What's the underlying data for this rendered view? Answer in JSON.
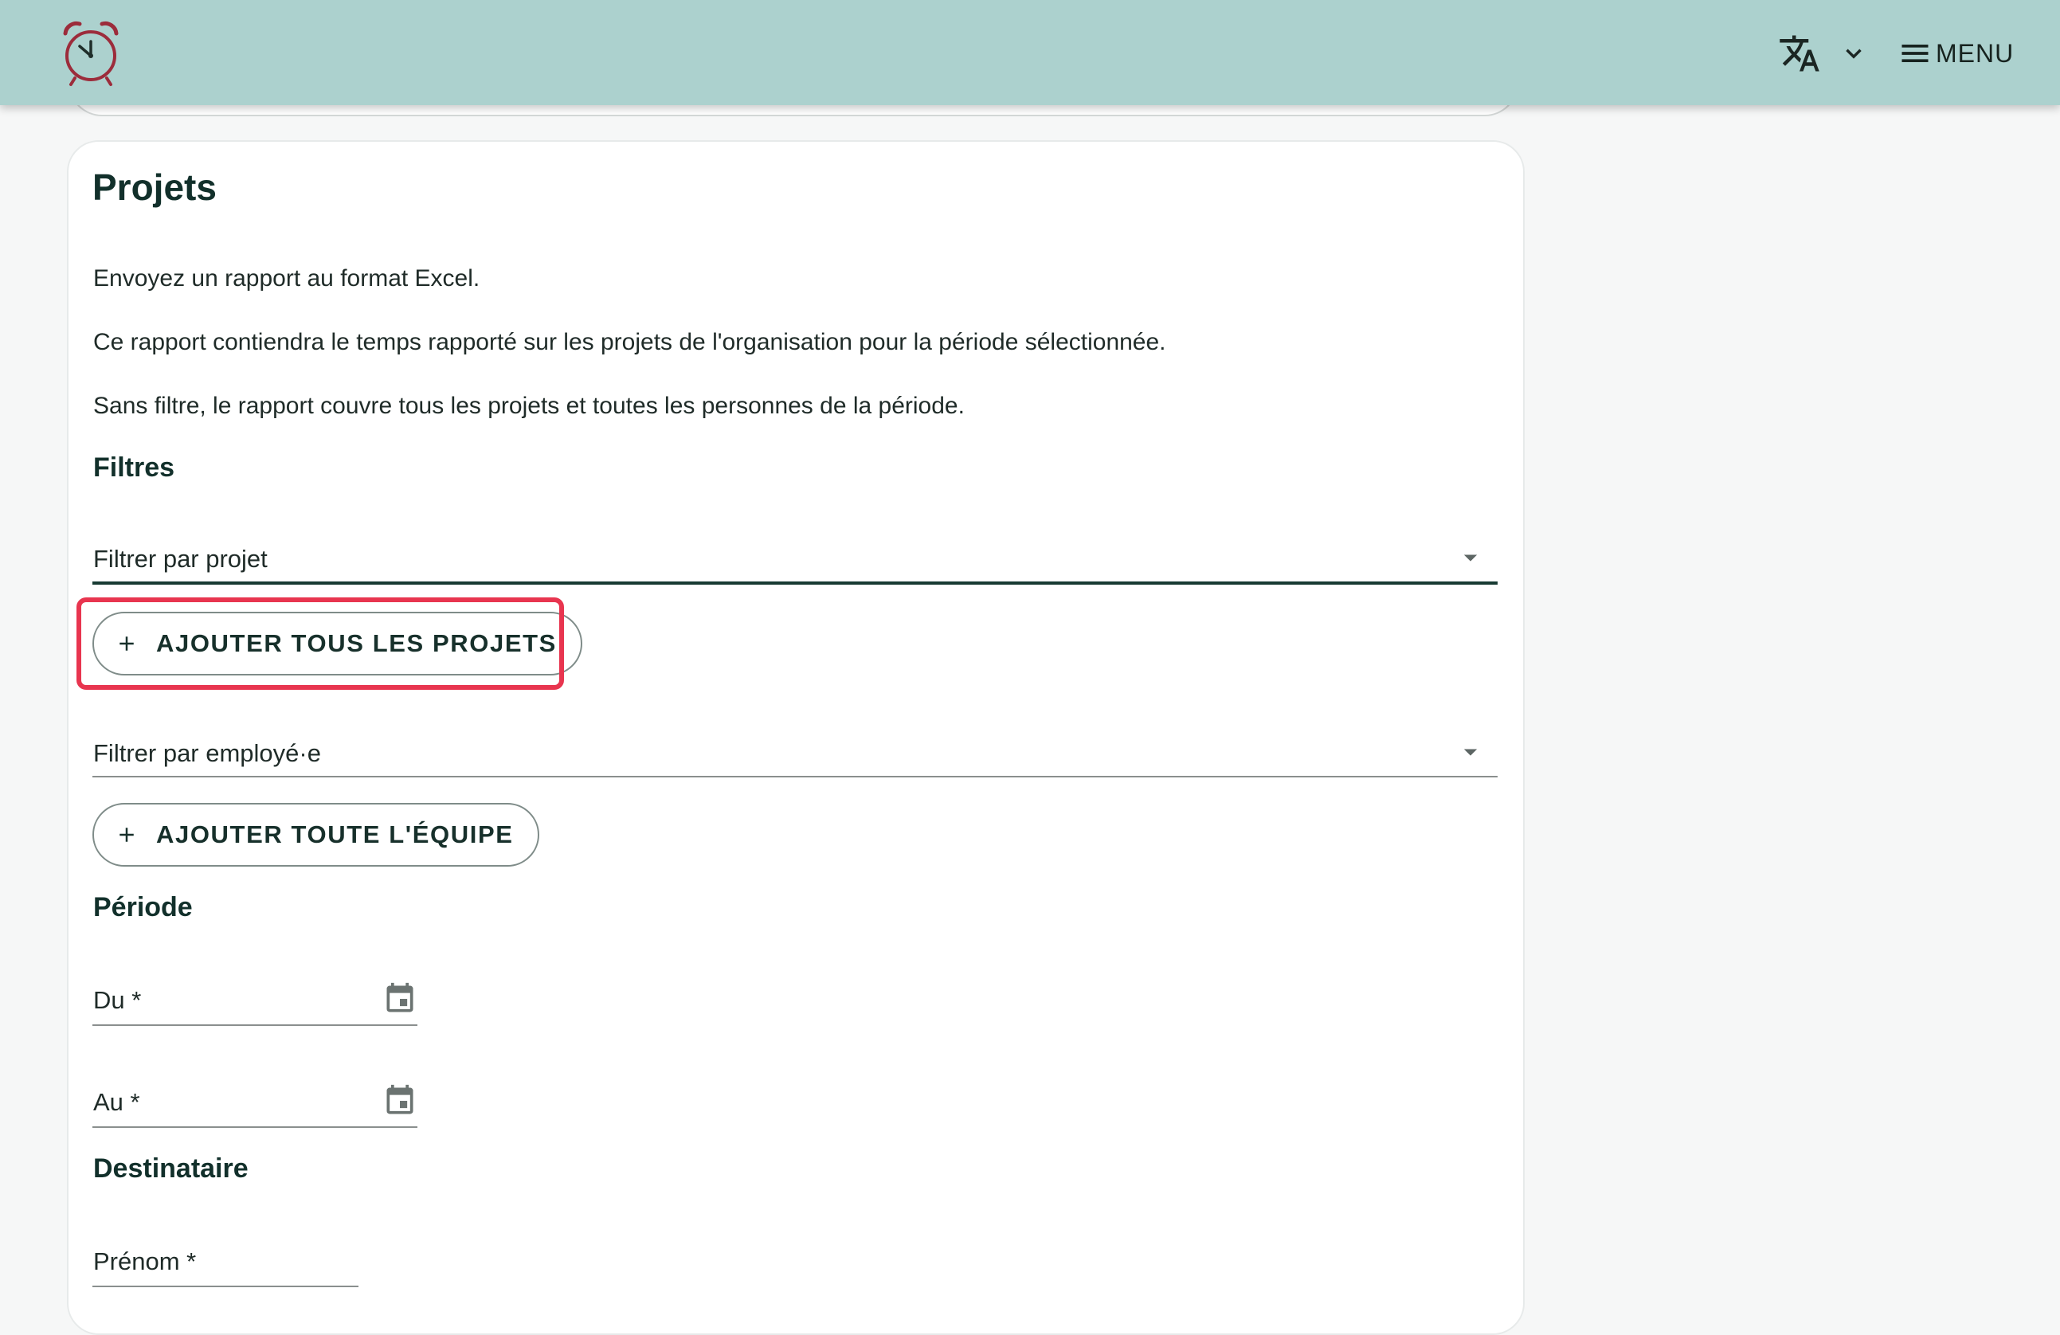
{
  "header": {
    "logo_icon": "alarm-clock-icon",
    "language_icon": "translate-icon",
    "menu_label": "MENU",
    "colors": {
      "bar": "#acd1ce",
      "accent": "#9c2c3b"
    }
  },
  "card": {
    "title": "Projets",
    "paragraphs": [
      "Envoyez un rapport au format Excel.",
      "Ce rapport contiendra le temps rapporté sur les projets de l'organisation pour la période sélectionnée.",
      "Sans filtre, le rapport couvre tous les projets et toutes les personnes de la période."
    ],
    "filters": {
      "heading": "Filtres",
      "project_select": "Filtrer par projet",
      "add_all_projects": "AJOUTER TOUS LES PROJETS",
      "employee_select": "Filtrer par employé·e",
      "add_whole_team": "AJOUTER TOUTE L'ÉQUIPE"
    },
    "period": {
      "heading": "Période",
      "from_label": "Du *",
      "to_label": "Au *"
    },
    "recipient": {
      "heading": "Destinataire",
      "first_name_label": "Prénom *"
    }
  },
  "highlight_color": "#e8354f"
}
